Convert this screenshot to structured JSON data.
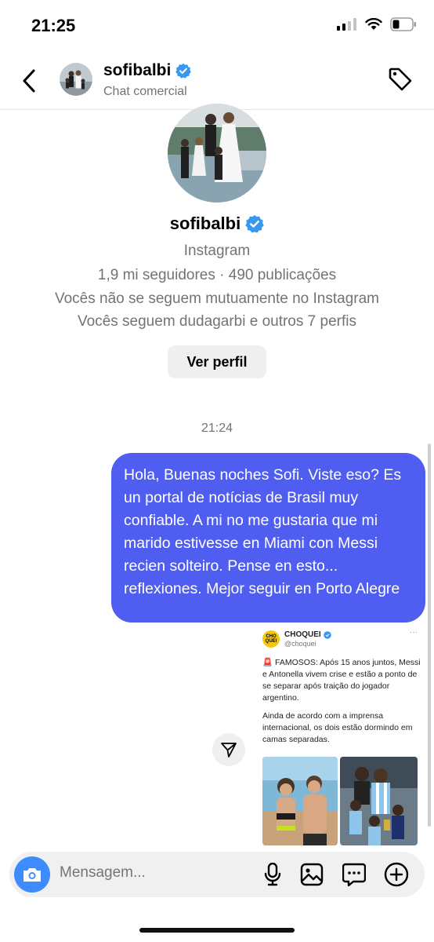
{
  "status": {
    "time": "21:25"
  },
  "header": {
    "name": "sofibalbi",
    "subtitle": "Chat comercial"
  },
  "profile": {
    "name": "sofibalbi",
    "platform": "Instagram",
    "stats": "1,9 mi seguidores · 490 publicações",
    "mutual": "Vocês não se seguem mutuamente no Instagram",
    "following": "Vocês seguem dudagarbi e outros 7 perfis",
    "view_profile_label": "Ver perfil"
  },
  "chat": {
    "timestamp": "21:24",
    "message": "Hola, Buenas noches Sofi. Viste eso? Es un portal de notícias de Brasil muy confiable. A mi no me gustaria que mi marido estivesse en Miami con Messi recien solteiro. Pense en esto... reflexiones. Mejor seguir en Porto Alegre",
    "shared_post": {
      "logo_text": "CHO QUEI",
      "account_name": "CHOQUEI",
      "handle": "@choquei",
      "more": "···",
      "paragraph1": "🚨 FAMOSOS: Após 15 anos juntos, Messi e Antonella vivem crise e estão a ponto de se separar após traição do jogador argentino.",
      "paragraph2": "Ainda de acordo com a imprensa internacional, os dois estão dormindo em camas separadas."
    }
  },
  "composer": {
    "placeholder": "Mensagem..."
  },
  "colors": {
    "bubble": "#4f5ef0",
    "verified": "#3897f0",
    "camera": "#3d8bfd"
  }
}
